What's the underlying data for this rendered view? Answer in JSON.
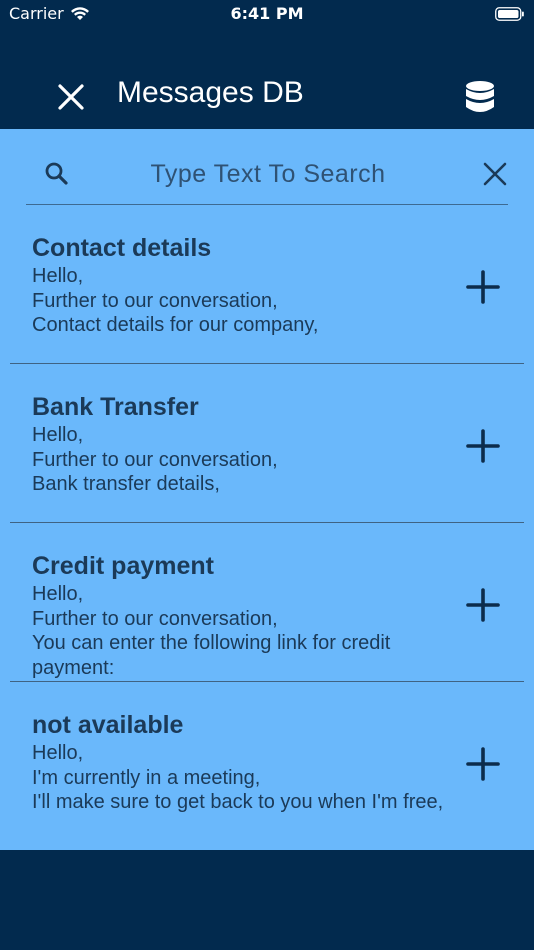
{
  "status": {
    "carrier": "Carrier",
    "time": "6:41 PM"
  },
  "header": {
    "title": "Messages DB",
    "close_icon": "close-icon",
    "db_icon": "database-icon"
  },
  "search": {
    "placeholder": "Type Text To Search",
    "value": ""
  },
  "messages": [
    {
      "title": "Contact details",
      "body": "Hello,\nFurther to our conversation,\nContact details for our company,"
    },
    {
      "title": "Bank Transfer",
      "body": "Hello,\nFurther to our conversation,\nBank transfer details,"
    },
    {
      "title": "Credit payment",
      "body": "Hello,\nFurther to our conversation,\n You can enter the following link for credit payment:"
    },
    {
      "title": "not available",
      "body": "Hello,\nI'm currently in a meeting,\nI'll make sure to get back to you when I'm free,"
    }
  ],
  "colors": {
    "navy": "#022a4e",
    "light_blue": "#6ab8fb",
    "text": "#1b3a58"
  }
}
